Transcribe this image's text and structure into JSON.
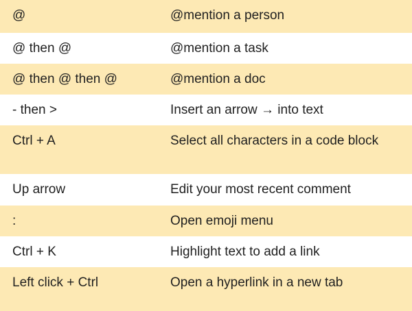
{
  "shortcuts": [
    {
      "keys": "@",
      "action": "@mention a person"
    },
    {
      "keys": "@ then @",
      "action": "@mention a task"
    },
    {
      "keys": "@ then @ then @",
      "action": "@mention a doc"
    },
    {
      "keys": "- then >",
      "action": "Insert an arrow → into text"
    },
    {
      "keys": "Ctrl + A",
      "action": "Select all characters in a code block"
    },
    {
      "keys": "Up arrow",
      "action": "Edit your most recent comment"
    },
    {
      "keys": ":",
      "action": "Open emoji menu"
    },
    {
      "keys": "Ctrl + K",
      "action": "Highlight text to add a link"
    },
    {
      "keys": "Left click + Ctrl",
      "action": "Open a hyperlink in a new tab"
    }
  ],
  "colors": {
    "row_shade": "#fde9b4",
    "row_plain": "#ffffff",
    "text": "#1f1f1f"
  }
}
